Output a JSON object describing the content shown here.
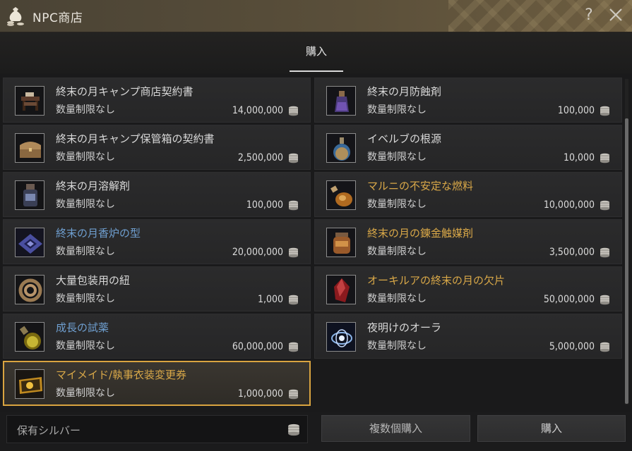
{
  "window": {
    "title": "NPC商店",
    "help_label": "?"
  },
  "tabs": [
    {
      "label": "購入",
      "active": true
    }
  ],
  "colors": {
    "accent_gold": "#d9a440",
    "name_blue": "#6f9fd0",
    "name_gold": "#d9a848"
  },
  "items": [
    {
      "name": "終末の月キャンプ商店契約書",
      "limit": "数量制限なし",
      "price": "14,000,000",
      "name_color": "normal",
      "icon": "desk-icon"
    },
    {
      "name": "終末の月防蝕剤",
      "limit": "数量制限なし",
      "price": "100,000",
      "name_color": "normal",
      "icon": "potion-bottle-icon"
    },
    {
      "name": "終末の月キャンプ保管箱の契約書",
      "limit": "数量制限なし",
      "price": "2,500,000",
      "name_color": "normal",
      "icon": "storage-chest-icon"
    },
    {
      "name": "イベルブの根源",
      "limit": "数量制限なし",
      "price": "10,000",
      "name_color": "normal",
      "icon": "flask-icon"
    },
    {
      "name": "終末の月溶解剤",
      "limit": "数量制限なし",
      "price": "100,000",
      "name_color": "normal",
      "icon": "jar-icon"
    },
    {
      "name": "マルニの不安定な燃料",
      "limit": "数量制限なし",
      "price": "10,000,000",
      "name_color": "gold",
      "icon": "fuel-flask-icon"
    },
    {
      "name": "終末の月香炉の型",
      "limit": "数量制限なし",
      "price": "20,000,000",
      "name_color": "blue",
      "icon": "mold-icon"
    },
    {
      "name": "終末の月の錬金触媒剤",
      "limit": "数量制限なし",
      "price": "3,500,000",
      "name_color": "gold",
      "icon": "catalyst-jar-icon"
    },
    {
      "name": "大量包装用の紐",
      "limit": "数量制限なし",
      "price": "1,000",
      "name_color": "normal",
      "icon": "rope-icon"
    },
    {
      "name": "オーキルアの終末の月の欠片",
      "limit": "数量制限なし",
      "price": "50,000,000",
      "name_color": "gold",
      "icon": "red-crystal-icon"
    },
    {
      "name": "成長の試薬",
      "limit": "数量制限なし",
      "price": "60,000,000",
      "name_color": "blue",
      "icon": "reagent-flask-icon"
    },
    {
      "name": "夜明けのオーラ",
      "limit": "数量制限なし",
      "price": "5,000,000",
      "name_color": "normal",
      "icon": "aura-icon"
    },
    {
      "name": "マイメイド/執事衣装変更券",
      "limit": "数量制限なし",
      "price": "1,000,000",
      "name_color": "gold",
      "icon": "ticket-icon",
      "selected": true
    }
  ],
  "footer": {
    "silver_label": "保有シルバー",
    "multi_buy_label": "複数個購入",
    "buy_label": "購入"
  }
}
